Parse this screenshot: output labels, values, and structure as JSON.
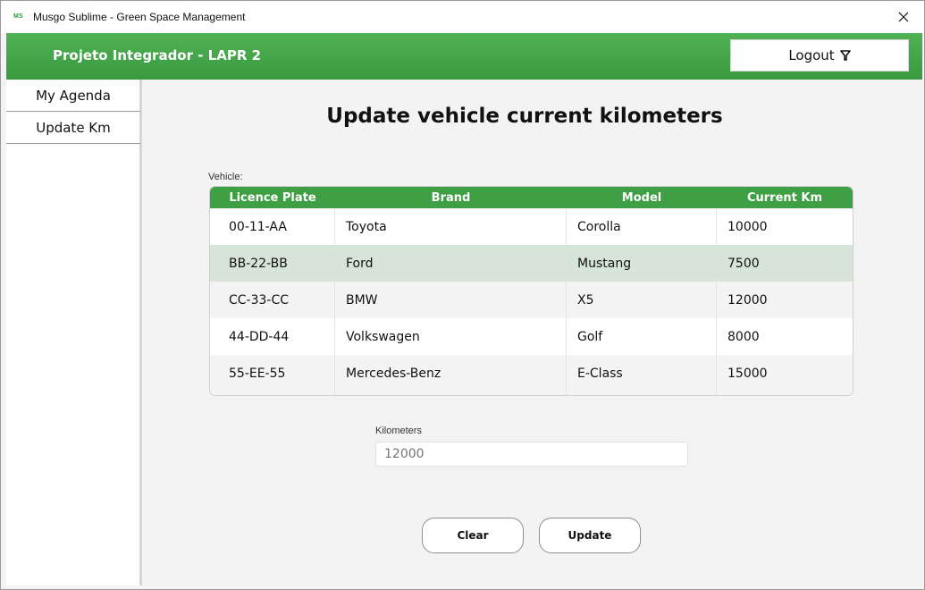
{
  "window": {
    "icon_text": "MS",
    "title": "Musgo Sublime - Green Space Management",
    "close_glyph": "✕"
  },
  "header": {
    "title": "Projeto Integrador - LAPR 2",
    "logout_label": "Logout",
    "logout_icon": "funnel-icon"
  },
  "sidebar": {
    "items": [
      {
        "label": "My Agenda"
      },
      {
        "label": "Update Km"
      }
    ]
  },
  "main": {
    "title": "Update vehicle current kilometers",
    "vehicle_label": "Vehicle:",
    "table": {
      "columns": [
        "Licence Plate",
        "Brand",
        "Model",
        "Current Km"
      ],
      "rows": [
        [
          "00-11-AA",
          "Toyota",
          "Corolla",
          "10000"
        ],
        [
          "BB-22-BB",
          "Ford",
          "Mustang",
          "7500"
        ],
        [
          "CC-33-CC",
          "BMW",
          "X5",
          "12000"
        ],
        [
          "44-DD-44",
          "Volkswagen",
          "Golf",
          "8000"
        ],
        [
          "55-EE-55",
          "Mercedes-Benz",
          "E-Class",
          "15000"
        ]
      ],
      "selected_row": 1
    },
    "km_label": "Kilometers",
    "km_placeholder": "12000",
    "clear_label": "Clear",
    "update_label": "Update"
  },
  "colors": {
    "header_green": "#3f9f45",
    "selected_row": "#d6e5d8"
  }
}
